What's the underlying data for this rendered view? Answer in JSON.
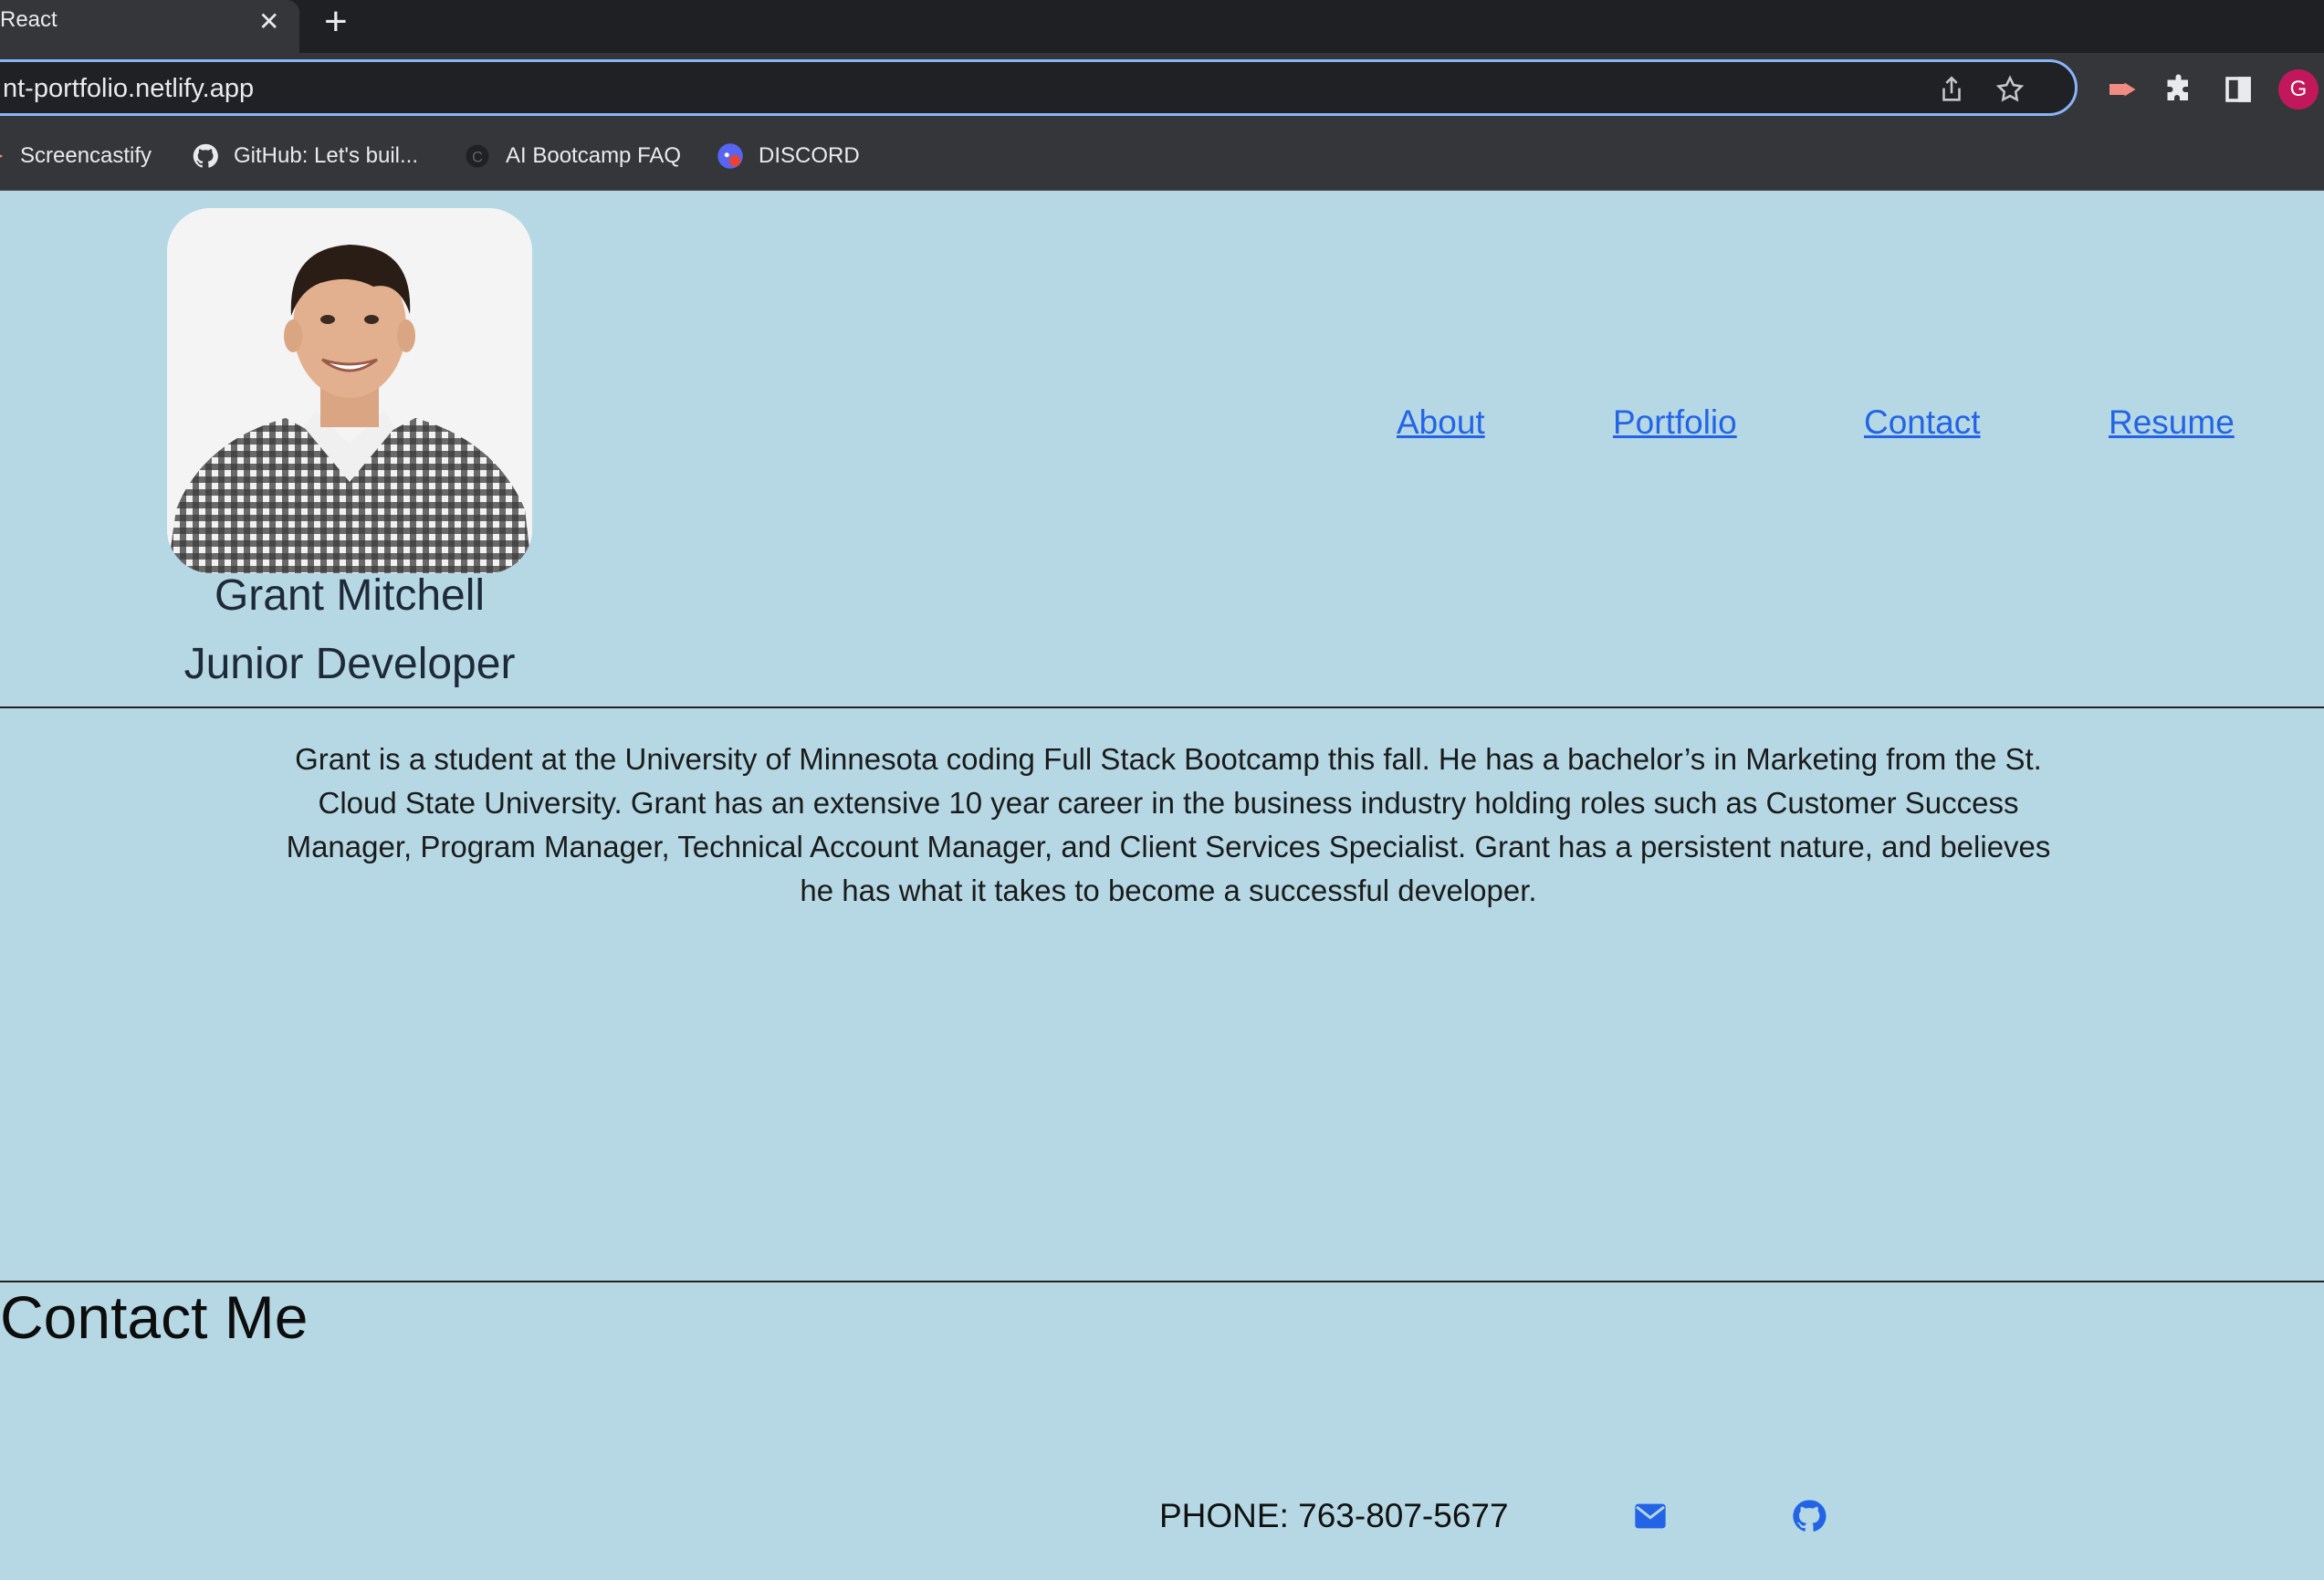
{
  "browser": {
    "tab_title": "React",
    "url": "nt-portfolio.netlify.app",
    "profile_initial": "G",
    "bookmarks": [
      {
        "label": "Screencastify",
        "icon": "screencastify-icon"
      },
      {
        "label": "GitHub: Let's buil...",
        "icon": "github-icon"
      },
      {
        "label": "AI Bootcamp FAQ",
        "icon": "site-icon"
      },
      {
        "label": "DISCORD",
        "icon": "discord-icon"
      }
    ]
  },
  "header": {
    "name": "Grant Mitchell",
    "title": "Junior Developer",
    "nav": [
      "About",
      "Portfolio",
      "Contact",
      "Resume"
    ]
  },
  "about": {
    "bio": "Grant is a student at the University of Minnesota coding Full Stack Bootcamp this fall. He has a bachelor’s in Marketing from the St. Cloud State University. Grant has an extensive 10 year career in the business industry holding roles such as Customer Success Manager, Program Manager, Technical Account Manager, and Client Services Specialist. Grant has a persistent nature, and believes he has what it takes to become a successful developer."
  },
  "contact": {
    "heading": "Contact Me",
    "phone": "PHONE: 763-807-5677",
    "icons": [
      "envelope-icon",
      "github-icon"
    ]
  },
  "colors": {
    "page_bg": "#b5d8e4",
    "link": "#2364e6",
    "chrome_dark": "#35363a",
    "omnibox_focus": "#8ab4f8"
  }
}
